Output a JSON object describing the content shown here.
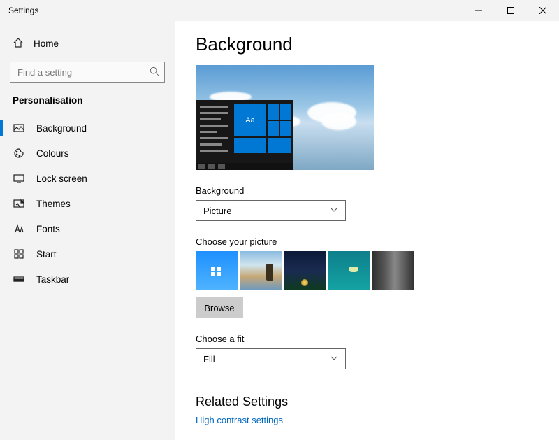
{
  "window": {
    "title": "Settings"
  },
  "home": {
    "label": "Home"
  },
  "search": {
    "placeholder": "Find a setting"
  },
  "section": {
    "title": "Personalisation"
  },
  "nav": {
    "items": [
      {
        "label": "Background",
        "icon": "picture-icon",
        "selected": true
      },
      {
        "label": "Colours",
        "icon": "palette-icon"
      },
      {
        "label": "Lock screen",
        "icon": "lockscreen-icon"
      },
      {
        "label": "Themes",
        "icon": "themes-icon"
      },
      {
        "label": "Fonts",
        "icon": "fonts-icon"
      },
      {
        "label": "Start",
        "icon": "start-icon"
      },
      {
        "label": "Taskbar",
        "icon": "taskbar-icon"
      }
    ]
  },
  "page": {
    "title": "Background",
    "preview_tile_text": "Aa",
    "bg_label": "Background",
    "bg_value": "Picture",
    "choose_picture_label": "Choose your picture",
    "browse_label": "Browse",
    "fit_label": "Choose a fit",
    "fit_value": "Fill",
    "related_heading": "Related Settings",
    "related_link": "High contrast settings"
  },
  "thumbs": [
    {
      "desc": "windows-default-blue"
    },
    {
      "desc": "beach-rock"
    },
    {
      "desc": "night-sky-stars"
    },
    {
      "desc": "underwater-turtle"
    },
    {
      "desc": "grey-rock"
    }
  ]
}
